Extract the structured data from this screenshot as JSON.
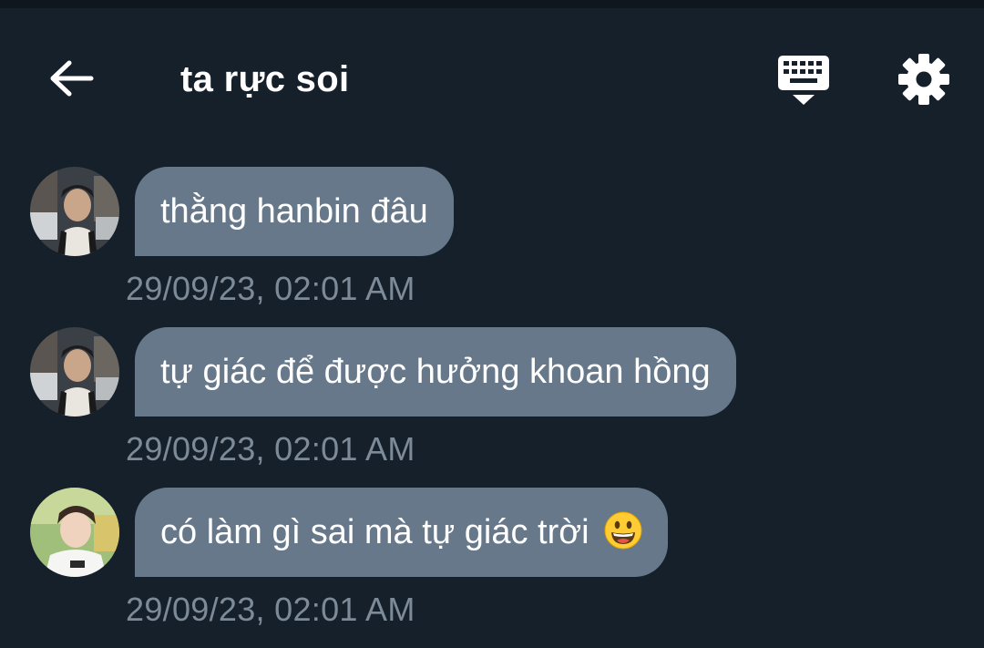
{
  "header": {
    "title": "ta rực soi",
    "back_icon": "arrow-left-icon",
    "keyboard_icon": "keyboard-icon",
    "settings_icon": "gear-icon"
  },
  "messages": [
    {
      "text": "thằng hanbin đâu",
      "timestamp": "29/09/23, 02:01 AM",
      "avatar": "avatar-dark-hair"
    },
    {
      "text": "tự giác để được hưởng khoan hồng",
      "timestamp": "29/09/23, 02:01 AM",
      "avatar": "avatar-dark-hair"
    },
    {
      "text": "có làm gì sai mà tự giác trời",
      "emoji": "grinning-face-emoji",
      "timestamp": "29/09/23, 02:01 AM",
      "avatar": "avatar-light-outdoor"
    }
  ],
  "colors": {
    "background": "#15202b",
    "bubble": "#66788a",
    "timestamp": "#7d8b99",
    "text": "#ffffff"
  }
}
